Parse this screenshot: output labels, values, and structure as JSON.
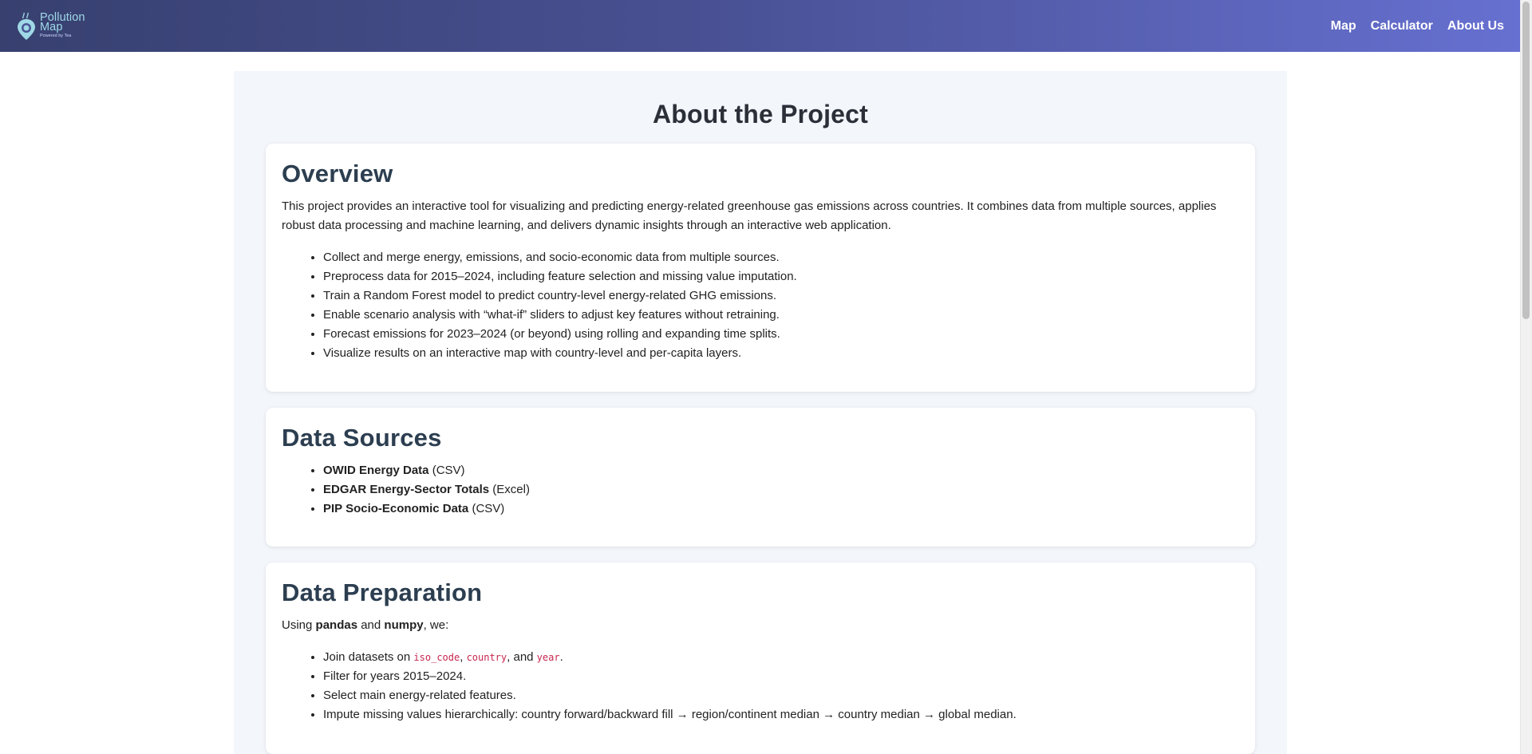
{
  "brand": {
    "name": "Pollution\nMap",
    "sub": "Powered by Tea"
  },
  "nav": {
    "map": "Map",
    "calculator": "Calculator",
    "about": "About Us"
  },
  "page": {
    "title": "About the Project"
  },
  "overview": {
    "heading": "Overview",
    "paragraph": "This project provides an interactive tool for visualizing and predicting energy-related greenhouse gas emissions across countries. It combines data from multiple sources, applies robust data processing and machine learning, and delivers dynamic insights through an interactive web application.",
    "items": [
      "Collect and merge energy, emissions, and socio-economic data from multiple sources.",
      "Preprocess data for 2015–2024, including feature selection and missing value imputation.",
      "Train a Random Forest model to predict country-level energy-related GHG emissions.",
      "Enable scenario analysis with “what-if” sliders to adjust key features without retraining.",
      "Forecast emissions for 2023–2024 (or beyond) using rolling and expanding time splits.",
      "Visualize results on an interactive map with country-level and per-capita layers."
    ]
  },
  "sources": {
    "heading": "Data Sources",
    "items": [
      {
        "name": "OWID Energy Data",
        "format": " (CSV)"
      },
      {
        "name": "EDGAR Energy-Sector Totals",
        "format": " (Excel)"
      },
      {
        "name": "PIP Socio-Economic Data",
        "format": " (CSV)"
      }
    ]
  },
  "prep": {
    "heading": "Data Preparation",
    "intro": {
      "before": "Using ",
      "lib1": "pandas",
      "mid": " and ",
      "lib2": "numpy",
      "after": ", we:"
    },
    "join": {
      "before": "Join datasets on ",
      "k1": "iso_code",
      "sep1": ", ",
      "k2": "country",
      "sep2": ", and ",
      "k3": "year",
      "after": "."
    },
    "items": [
      "Filter for years 2015–2024.",
      "Select main energy-related features.",
      "Impute missing values hierarchically: country forward/backward fill → region/continent median → country median → global median."
    ]
  },
  "colors": {
    "header_start": "#37406f",
    "header_end": "#6670d0",
    "heading": "#2c3e50",
    "code": "#c7254e"
  }
}
